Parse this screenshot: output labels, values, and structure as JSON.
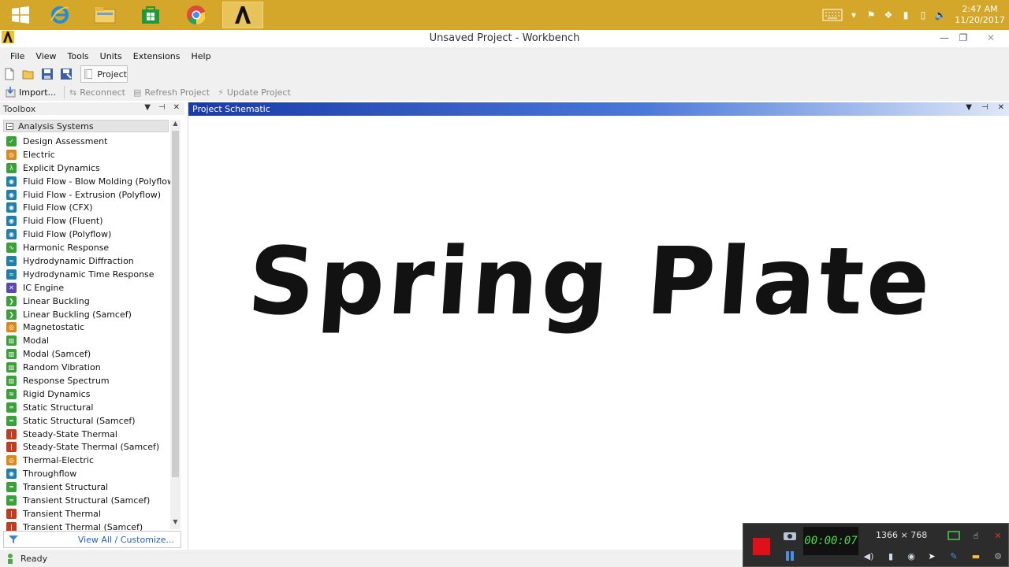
{
  "taskbar": {
    "apps": [
      {
        "name": "windows-start",
        "icon": "windows-logo-icon"
      },
      {
        "name": "internet-explorer",
        "icon": "ie-icon"
      },
      {
        "name": "file-explorer",
        "icon": "folder-icon"
      },
      {
        "name": "store",
        "icon": "store-icon"
      },
      {
        "name": "chrome",
        "icon": "chrome-icon"
      },
      {
        "name": "ansys",
        "icon": "ansys-icon"
      }
    ],
    "clock_time": "2:47 AM",
    "clock_date": "11/20/2017"
  },
  "window": {
    "title": "Unsaved Project - Workbench"
  },
  "menu": {
    "items": [
      "File",
      "View",
      "Tools",
      "Units",
      "Extensions",
      "Help"
    ]
  },
  "toolbar": {
    "project_tab": "Project",
    "import": "Import...",
    "reconnect": "Reconnect",
    "refresh": "Refresh Project",
    "update": "Update Project"
  },
  "toolbox": {
    "title": "Toolbox",
    "group": "Analysis Systems",
    "items": [
      {
        "label": "Design Assessment",
        "color": "#3aa13a",
        "glyph": "✓"
      },
      {
        "label": "Electric",
        "color": "#d98a1a",
        "glyph": "◎"
      },
      {
        "label": "Explicit Dynamics",
        "color": "#3aa13a",
        "glyph": "λ"
      },
      {
        "label": "Fluid Flow - Blow Molding (Polyflow)",
        "color": "#1e7fa8",
        "glyph": "◉"
      },
      {
        "label": "Fluid Flow - Extrusion (Polyflow)",
        "color": "#1e7fa8",
        "glyph": "◉"
      },
      {
        "label": "Fluid Flow (CFX)",
        "color": "#1e7fa8",
        "glyph": "◉"
      },
      {
        "label": "Fluid Flow (Fluent)",
        "color": "#1e7fa8",
        "glyph": "◉"
      },
      {
        "label": "Fluid Flow (Polyflow)",
        "color": "#1e7fa8",
        "glyph": "◉"
      },
      {
        "label": "Harmonic Response",
        "color": "#3aa13a",
        "glyph": "∿"
      },
      {
        "label": "Hydrodynamic Diffraction",
        "color": "#1e7fa8",
        "glyph": "≈"
      },
      {
        "label": "Hydrodynamic Time Response",
        "color": "#1e7fa8",
        "glyph": "≈"
      },
      {
        "label": "IC Engine",
        "color": "#5a4ab0",
        "glyph": "✕"
      },
      {
        "label": "Linear Buckling",
        "color": "#3aa13a",
        "glyph": "❯"
      },
      {
        "label": "Linear Buckling (Samcef)",
        "color": "#3aa13a",
        "glyph": "❯"
      },
      {
        "label": "Magnetostatic",
        "color": "#d98a1a",
        "glyph": "◎"
      },
      {
        "label": "Modal",
        "color": "#3aa13a",
        "glyph": "▥"
      },
      {
        "label": "Modal (Samcef)",
        "color": "#3aa13a",
        "glyph": "▥"
      },
      {
        "label": "Random Vibration",
        "color": "#3aa13a",
        "glyph": "▥"
      },
      {
        "label": "Response Spectrum",
        "color": "#3aa13a",
        "glyph": "▥"
      },
      {
        "label": "Rigid Dynamics",
        "color": "#3aa13a",
        "glyph": "≋"
      },
      {
        "label": "Static Structural",
        "color": "#3aa13a",
        "glyph": "═"
      },
      {
        "label": "Static Structural (Samcef)",
        "color": "#3aa13a",
        "glyph": "═"
      },
      {
        "label": "Steady-State Thermal",
        "color": "#c23b1e",
        "glyph": "ǀ"
      },
      {
        "label": "Steady-State Thermal (Samcef)",
        "color": "#c23b1e",
        "glyph": "ǀ"
      },
      {
        "label": "Thermal-Electric",
        "color": "#d98a1a",
        "glyph": "◎"
      },
      {
        "label": "Throughflow",
        "color": "#1e7fa8",
        "glyph": "◉"
      },
      {
        "label": "Transient Structural",
        "color": "#3aa13a",
        "glyph": "═"
      },
      {
        "label": "Transient Structural (Samcef)",
        "color": "#3aa13a",
        "glyph": "═"
      },
      {
        "label": "Transient Thermal",
        "color": "#c23b1e",
        "glyph": "ǀ"
      },
      {
        "label": "Transient Thermal (Samcef)",
        "color": "#c23b1e",
        "glyph": "ǀ"
      }
    ],
    "footer_link": "View All / Customize..."
  },
  "schematic": {
    "title": "Project Schematic",
    "overlay_text": "Spring Plate"
  },
  "status": {
    "text": "Ready"
  },
  "recorder": {
    "timer": "00:00:07",
    "resolution": "1366 × 768"
  }
}
